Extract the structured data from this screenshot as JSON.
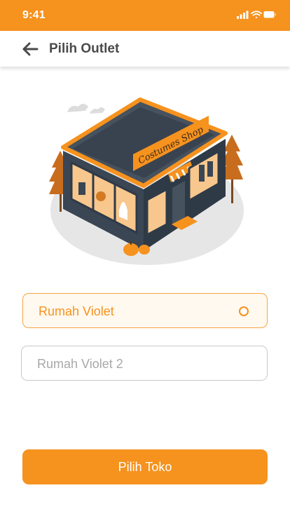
{
  "status_bar": {
    "time": "9:41",
    "icons": [
      "signal-icon",
      "wifi-icon",
      "battery-icon"
    ]
  },
  "app_bar": {
    "title": "Pilih Outlet",
    "back_icon": "arrow-left-icon"
  },
  "illustration": {
    "sign_text": "Costumes Shop"
  },
  "outlets": [
    {
      "label": "Rumah Violet",
      "selected": true
    },
    {
      "label": "Rumah Violet 2",
      "selected": false
    }
  ],
  "action": {
    "label": "Pilih Toko"
  },
  "colors": {
    "accent": "#f6921e",
    "selected_bg": "#fff9ef",
    "border": "#c9c9c9"
  }
}
